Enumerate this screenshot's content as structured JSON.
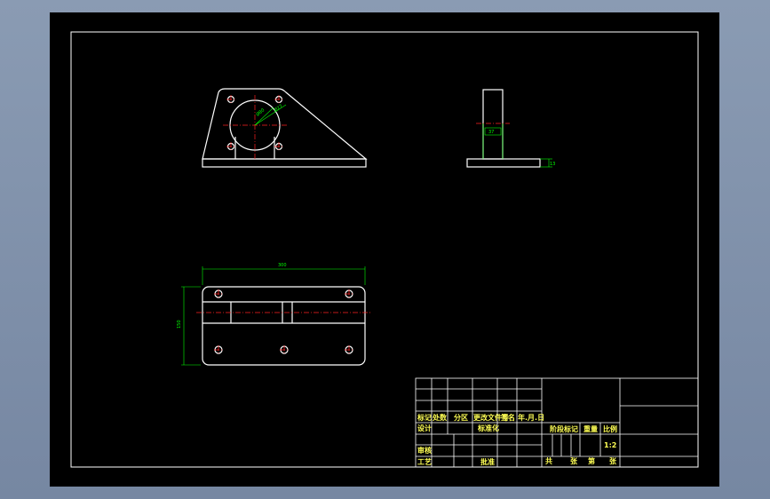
{
  "dimensions": {
    "dia_a": "Ø80",
    "dia_b": "Ø27",
    "side_height": "37",
    "side_thickness": "13",
    "top_width": "300",
    "top_height": "150"
  },
  "title_block": {
    "mark": "标记",
    "count": "处数",
    "zone": "分区",
    "change_doc": "更改文件号",
    "signature": "签名",
    "date": "年.月.日",
    "design": "设计",
    "standardize": "标准化",
    "review": "审核",
    "process": "工艺",
    "approve": "批准",
    "stage_mark": "阶段标记",
    "weight": "重量",
    "scale_label": "比例",
    "scale_value": "1:2",
    "total": "共",
    "sheets": "张",
    "page": "第",
    "sheet_unit": "张"
  },
  "colors": {
    "outline": "#ffffff",
    "centerline": "#ff2020",
    "dimension": "#00ff00",
    "text": "#ffff55"
  }
}
